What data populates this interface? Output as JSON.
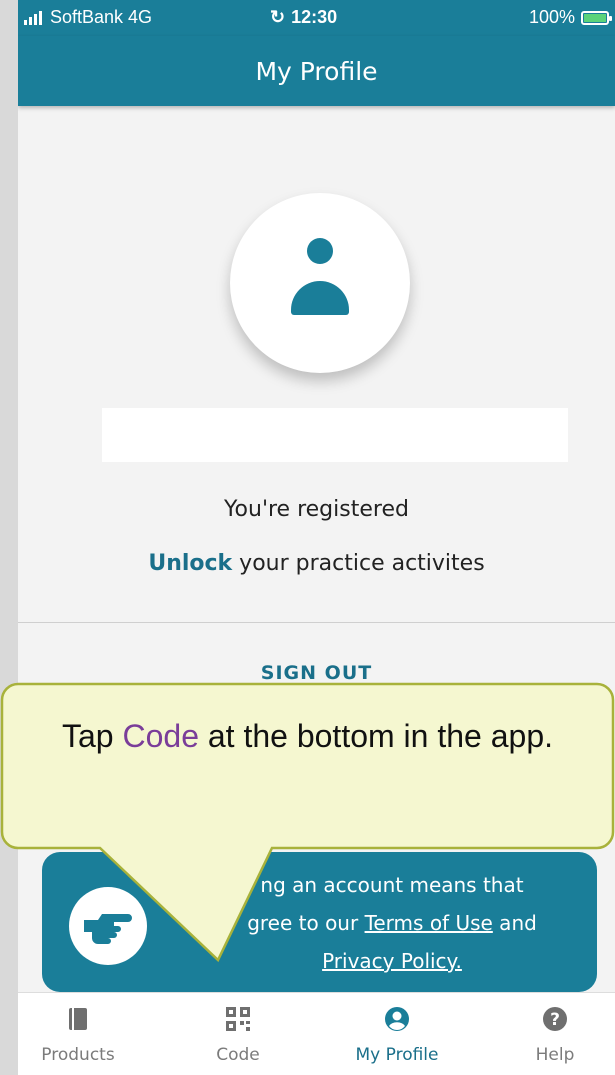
{
  "status_bar": {
    "carrier": "SoftBank 4G",
    "time": "12:30",
    "battery": "100%"
  },
  "header": {
    "title": "My Profile"
  },
  "profile": {
    "registered_text": "You're registered",
    "unlock_link": "Unlock",
    "unlock_rest": " your practice activites",
    "sign_out": "SIGN OUT"
  },
  "info_card": {
    "line1": "ng an account means that",
    "line2_a": "gree to our ",
    "terms_link": "Terms of Use",
    "line2_b": " and",
    "privacy_link": "Privacy Policy."
  },
  "callout": {
    "prefix": "Tap ",
    "highlight": "Code",
    "suffix": " at the bottom in the app."
  },
  "tabbar": {
    "products": "Products",
    "code": "Code",
    "my_profile": "My Profile",
    "help": "Help"
  },
  "colors": {
    "primary": "#1a7e99",
    "callout_fill": "#f5f7d0",
    "callout_border": "#a8b23b",
    "highlight": "#7a3d99"
  }
}
